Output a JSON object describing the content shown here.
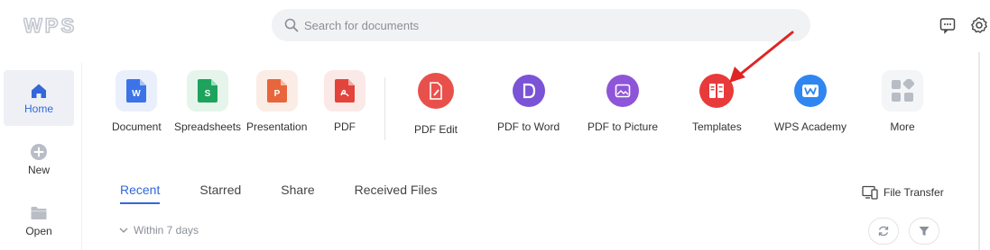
{
  "brand": {
    "logo_text": "WPS"
  },
  "search": {
    "placeholder": "Search for documents"
  },
  "sidebar": {
    "items": [
      {
        "label": "Home",
        "icon": "home-icon",
        "active": true
      },
      {
        "label": "New",
        "icon": "plus-circle-icon"
      },
      {
        "label": "Open",
        "icon": "folder-icon"
      }
    ]
  },
  "apps": {
    "create": [
      {
        "label": "Document",
        "icon": "writer-doc-icon",
        "color": "#3c74e8"
      },
      {
        "label": "Spreadsheets",
        "icon": "spreadsheet-doc-icon",
        "color": "#1ea35c"
      },
      {
        "label": "Presentation",
        "icon": "presentation-doc-icon",
        "color": "#e8663c"
      },
      {
        "label": "PDF",
        "icon": "pdf-doc-icon",
        "color": "#e2443c"
      }
    ],
    "tools": [
      {
        "label": "PDF Edit",
        "icon": "pdf-edit-icon",
        "color": "#e8514b"
      },
      {
        "label": "PDF to Word",
        "icon": "pdf-to-word-icon",
        "color": "#7b53d6"
      },
      {
        "label": "PDF to Picture",
        "icon": "pdf-to-picture-icon",
        "color": "#8e55d8"
      },
      {
        "label": "Templates",
        "icon": "templates-icon",
        "color": "#e83a3a"
      },
      {
        "label": "WPS Academy",
        "icon": "wps-academy-icon",
        "color": "#2f86f0"
      },
      {
        "label": "More",
        "icon": "more-grid-icon",
        "color": "#b8bcc4"
      }
    ]
  },
  "tabs": [
    "Recent",
    "Starred",
    "Share",
    "Received Files"
  ],
  "actions": {
    "file_transfer": "File Transfer",
    "filter_range": "Within 7 days"
  },
  "colors": {
    "accent": "#3268d8",
    "annotation_arrow": "#e02424"
  }
}
